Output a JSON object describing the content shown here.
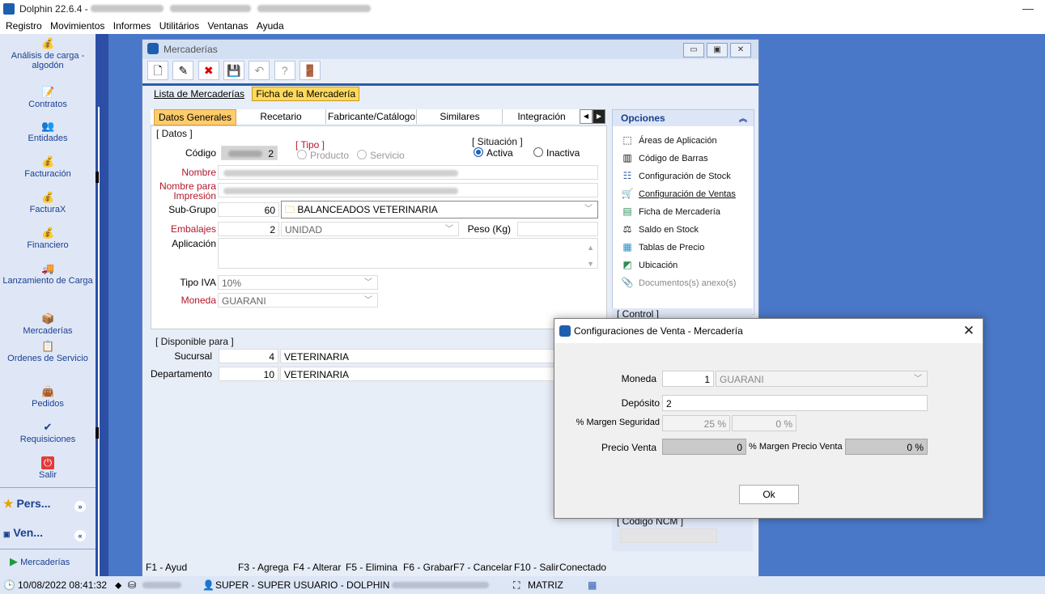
{
  "app": {
    "title": "Dolphin 22.6.4 -",
    "minimize_glyph": "—"
  },
  "menu": [
    "Registro",
    "Movimientos",
    "Informes",
    "Utilitários",
    "Ventanas",
    "Ayuda"
  ],
  "sidebar": {
    "items": [
      {
        "label": "Análisis de carga - algodón",
        "icon": "money-bag-icon"
      },
      {
        "label": "Contratos",
        "icon": "contract-icon"
      },
      {
        "label": "Entidades",
        "icon": "people-icon"
      },
      {
        "label": "Facturación",
        "icon": "money-bag-icon"
      },
      {
        "label": "FacturaX",
        "icon": "money-bag-icon"
      },
      {
        "label": "Financiero",
        "icon": "money-bag-icon"
      },
      {
        "label": "Lanzamiento de Carga",
        "icon": "truck-icon"
      },
      {
        "label": "Mercaderías",
        "icon": "box-icon"
      },
      {
        "label": "Ordenes de Servicio",
        "icon": "clipboard-icon"
      },
      {
        "label": "Pedidos",
        "icon": "bag-icon"
      },
      {
        "label": "Requisiciones",
        "icon": "check-icon"
      },
      {
        "label": "Salir",
        "icon": "power-icon"
      }
    ],
    "groups": [
      {
        "label": "Pers...",
        "icon": "star-icon"
      },
      {
        "label": "Ven...",
        "icon": "sales-icon"
      }
    ],
    "footer_item": "Mercaderías"
  },
  "window": {
    "title": "Mercaderías",
    "outer_tabs": [
      "Lista de Mercaderías",
      "Ficha de la Mercadería"
    ],
    "inner_tabs": [
      "Datos Generales",
      "Recetario",
      "Fabricante/Catálogo",
      "Similares",
      "Integración"
    ],
    "datos_legend": "[ Datos ]",
    "tipo_legend": "[ Tipo ]",
    "tipo_options": [
      "Producto",
      "Servicio"
    ],
    "situacion_legend": "[ Situación ]",
    "situacion_options": [
      "Activa",
      "Inactiva"
    ],
    "labels": {
      "codigo": "Código",
      "nombre": "Nombre",
      "nombre_impresion": "Nombre para Impresión",
      "subgrupo": "Sub-Grupo",
      "embalajes": "Embalajes",
      "peso": "Peso (Kg)",
      "aplicacion": "Aplicación",
      "tipo_iva": "Tipo IVA",
      "moneda": "Moneda"
    },
    "values": {
      "codigo_suffix": "2",
      "subgrupo_code": "60",
      "subgrupo_name": "BALANCEADOS VETERINARIA",
      "embalajes_code": "2",
      "embalajes_name": "UNIDAD",
      "tipo_iva": "10%",
      "moneda": "GUARANI"
    },
    "disponible_legend": "[ Disponible para ]",
    "sucursal_label": "Sucursal",
    "sucursal_code": "4",
    "sucursal_name": "VETERINARIA",
    "departamento_label": "Departamento",
    "departamento_code": "10",
    "departamento_name": "VETERINARIA",
    "status": [
      "F1 - Ayud",
      "F3 - Agrega",
      "F4 - Alterar",
      "F5 - Elimina",
      "F6 - Grabar",
      "F7 - Cancelar",
      "F10 - Salir",
      "Conectado"
    ]
  },
  "options": {
    "header": "Opciones",
    "items": [
      {
        "label": "Áreas de Aplicación",
        "icon": "dotted-square-icon"
      },
      {
        "label": "Código de Barras",
        "icon": "barcode-icon"
      },
      {
        "label": "Configuración de Stock",
        "icon": "stock-icon"
      },
      {
        "label": "Configuración de Ventas",
        "icon": "cart-icon"
      },
      {
        "label": "Ficha de Mercadería",
        "icon": "sheet-icon"
      },
      {
        "label": "Saldo en Stock",
        "icon": "stock-balance-icon"
      },
      {
        "label": "Tablas de Precio",
        "icon": "price-table-icon"
      },
      {
        "label": "Ubicación",
        "icon": "location-icon"
      },
      {
        "label": "Documentos(s) anexo(s)",
        "icon": "attachment-icon"
      }
    ],
    "control_legend": "[ Control ]",
    "ncm_legend": "[ Código NCM ]"
  },
  "dialog": {
    "title": "Configuraciones de Venta - Mercadería",
    "moneda_label": "Moneda",
    "moneda_code": "1",
    "moneda_name": "GUARANI",
    "deposito_label": "Depósito",
    "deposito_value": "2",
    "margen_seg_label": "% Margen Seguridad",
    "margen_seg_value": "25 %",
    "margen_seg_value2": "0 %",
    "precio_label": "Precio Venta",
    "precio_value": "0",
    "margen_precio_label": "% Margen Precio Venta",
    "margen_precio_value": "0 %",
    "ok_label": "Ok"
  },
  "taskbar": {
    "datetime": "10/08/2022 08:41:32",
    "user": "SUPER - SUPER USUARIO - DOLPHIN",
    "branch": "MATRIZ"
  }
}
